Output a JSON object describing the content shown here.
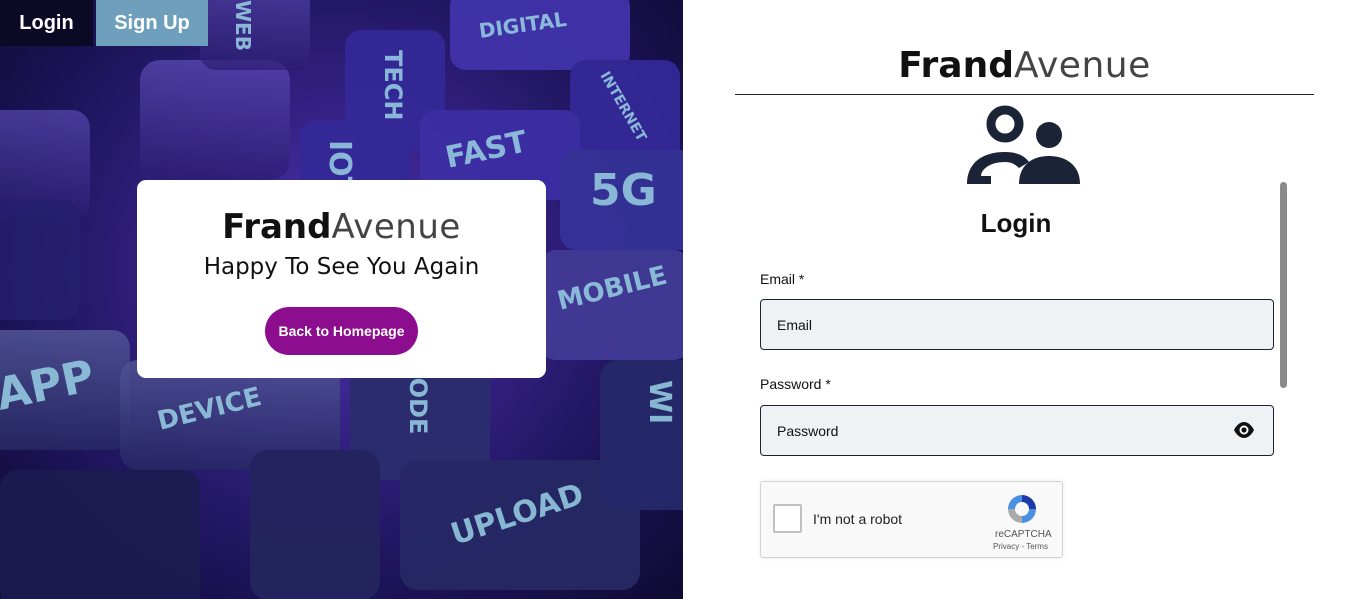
{
  "nav": {
    "login_label": "Login",
    "signup_label": "Sign Up"
  },
  "hero": {
    "brand_bold": "Frand",
    "brand_light": "Avenue",
    "greeting": "Happy To See You Again",
    "home_button": "Back to Homepage",
    "key_labels": [
      "DIGITAL",
      "TECH",
      "INTERNET",
      "FAST",
      "5G",
      "IOT",
      "MOBILE",
      "APP",
      "DEVICE",
      "CODE",
      "UPLOAD",
      "WI",
      "WEB"
    ]
  },
  "panel": {
    "brand_bold": "Frand",
    "brand_light": "Avenue",
    "title": "Login",
    "email_label": "Email *",
    "email_placeholder": "Email",
    "password_label": "Password *",
    "password_placeholder": "Password",
    "captcha": {
      "text": "I'm not a robot",
      "brand": "reCAPTCHA",
      "links": "Privacy - Terms"
    }
  },
  "colors": {
    "login_tab": "#0b0a24",
    "signup_tab": "#6e9fbd",
    "home_button": "#8c0e8e",
    "icon_navy": "#1b2336",
    "field_bg": "#eef2f5"
  },
  "icons": [
    "users-icon",
    "eye-icon",
    "recaptcha-logo-icon"
  ]
}
